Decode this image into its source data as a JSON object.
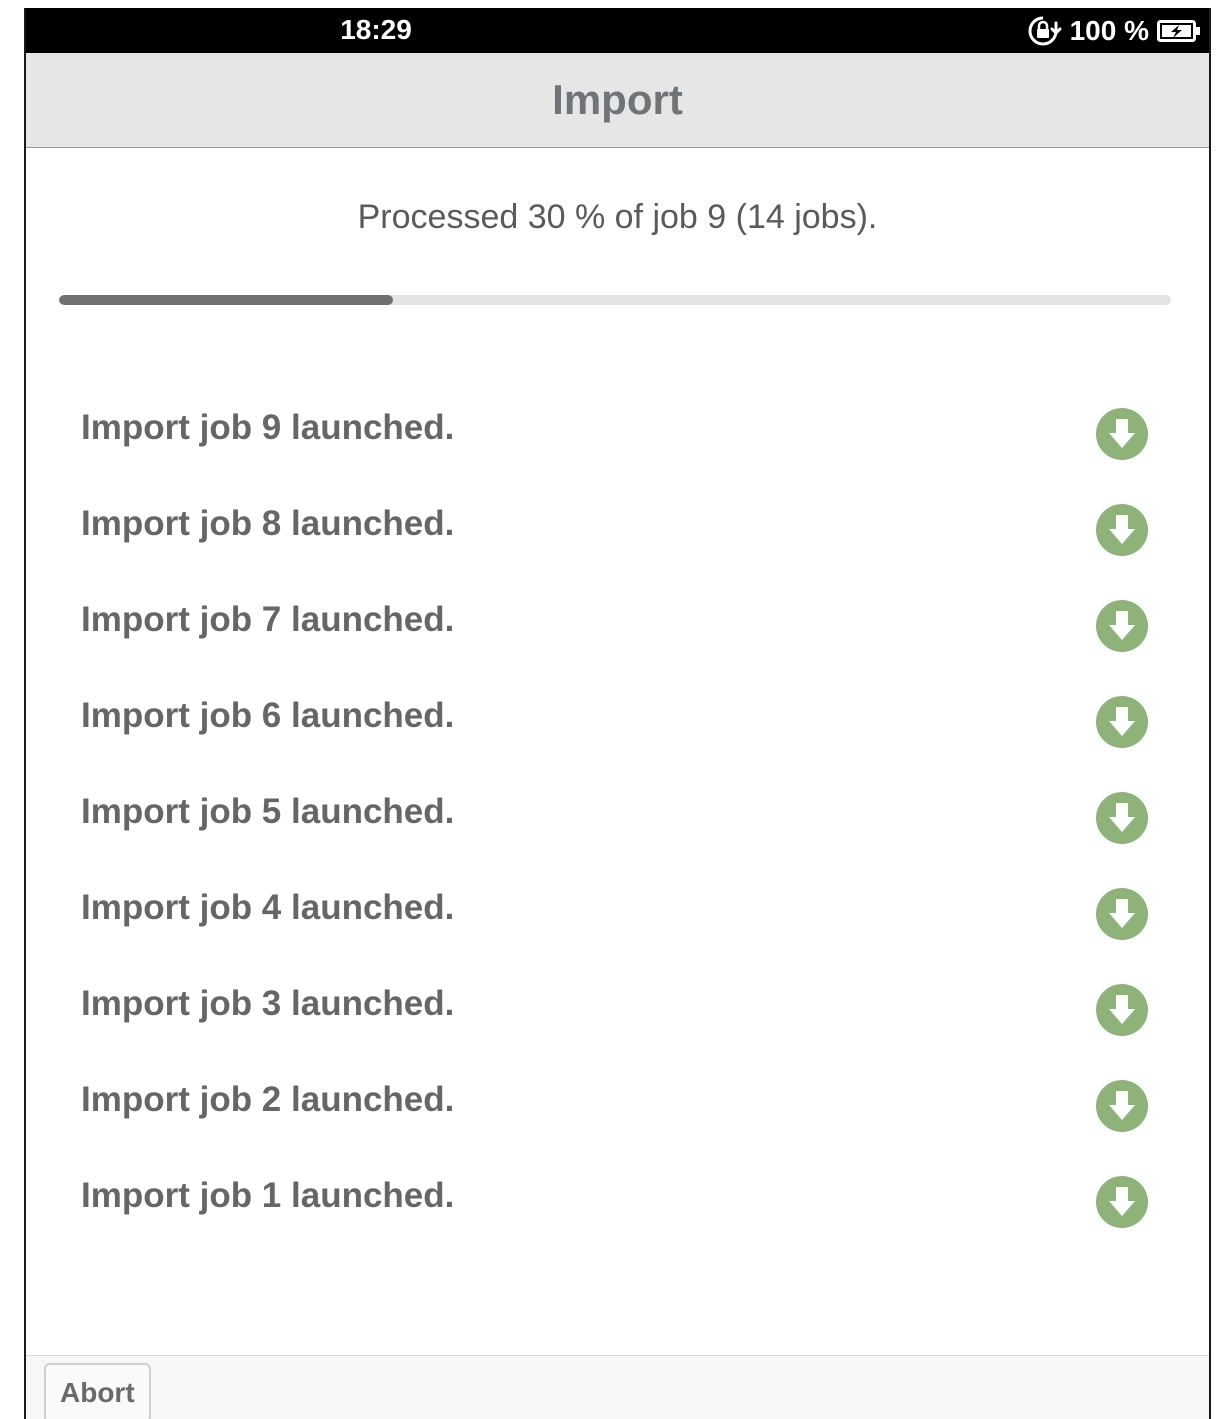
{
  "status_bar": {
    "time": "18:29",
    "battery_text": "100 %",
    "icons": [
      "rotation-lock-icon",
      "battery-charging-icon"
    ]
  },
  "header": {
    "title": "Import"
  },
  "progress": {
    "text": "Processed 30 % of job 9 (14 jobs).",
    "fraction": 0.3
  },
  "jobs": [
    {
      "label": "Import job 9 launched.",
      "icon": "download-icon"
    },
    {
      "label": "Import job 8 launched.",
      "icon": "download-icon"
    },
    {
      "label": "Import job 7 launched.",
      "icon": "download-icon"
    },
    {
      "label": "Import job 6 launched.",
      "icon": "download-icon"
    },
    {
      "label": "Import job 5 launched.",
      "icon": "download-icon"
    },
    {
      "label": "Import job 4 launched.",
      "icon": "download-icon"
    },
    {
      "label": "Import job 3 launched.",
      "icon": "download-icon"
    },
    {
      "label": "Import job 2 launched.",
      "icon": "download-icon"
    },
    {
      "label": "Import job 1 launched.",
      "icon": "download-icon"
    }
  ],
  "footer": {
    "abort_label": "Abort"
  },
  "colors": {
    "icon_green": "#8fb27a",
    "progress_fill": "#707070",
    "progress_track": "#e3e3e3",
    "header_bg": "#e6e6e6"
  }
}
